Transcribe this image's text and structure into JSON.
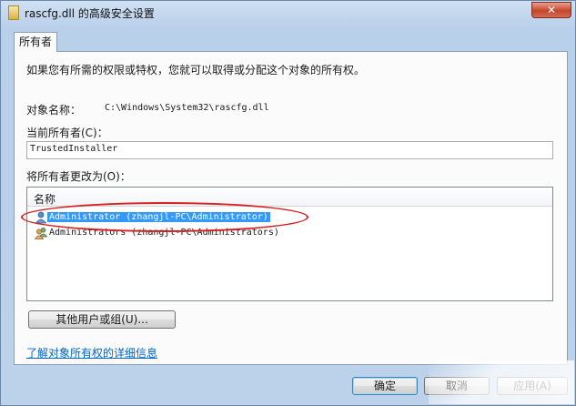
{
  "window": {
    "title": "rascfg.dll 的高级安全设置",
    "close_label": "✕"
  },
  "tabs": [
    {
      "label": "所有者"
    }
  ],
  "panel": {
    "intro": "如果您有所需的权限或特权，您就可以取得或分配这个对象的所有权。",
    "object_name_label": "对象名称：",
    "object_name_value": "C:\\Windows\\System32\\rascfg.dll",
    "current_owner_label": "当前所有者(C)：",
    "current_owner_value": "TrustedInstaller",
    "change_owner_label": "将所有者更改为(O)：",
    "list_header": "名称",
    "list_items": [
      {
        "label": "Administrator (zhangjl-PC\\Administrator)",
        "icon": "user-icon",
        "selected": true
      },
      {
        "label": "Administrators (zhangjl-PC\\Administrators)",
        "icon": "group-icon",
        "selected": false
      }
    ],
    "other_users_button": "其他用户或组(U)...",
    "learn_more_link": "了解对象所有权的详细信息"
  },
  "footer": {
    "ok_button": "确定",
    "cancel_button": "取消",
    "apply_button": "应用(A)"
  },
  "colors": {
    "selection": "#3399ff",
    "annotation_oval": "#d81f1f",
    "link": "#0066cc"
  }
}
